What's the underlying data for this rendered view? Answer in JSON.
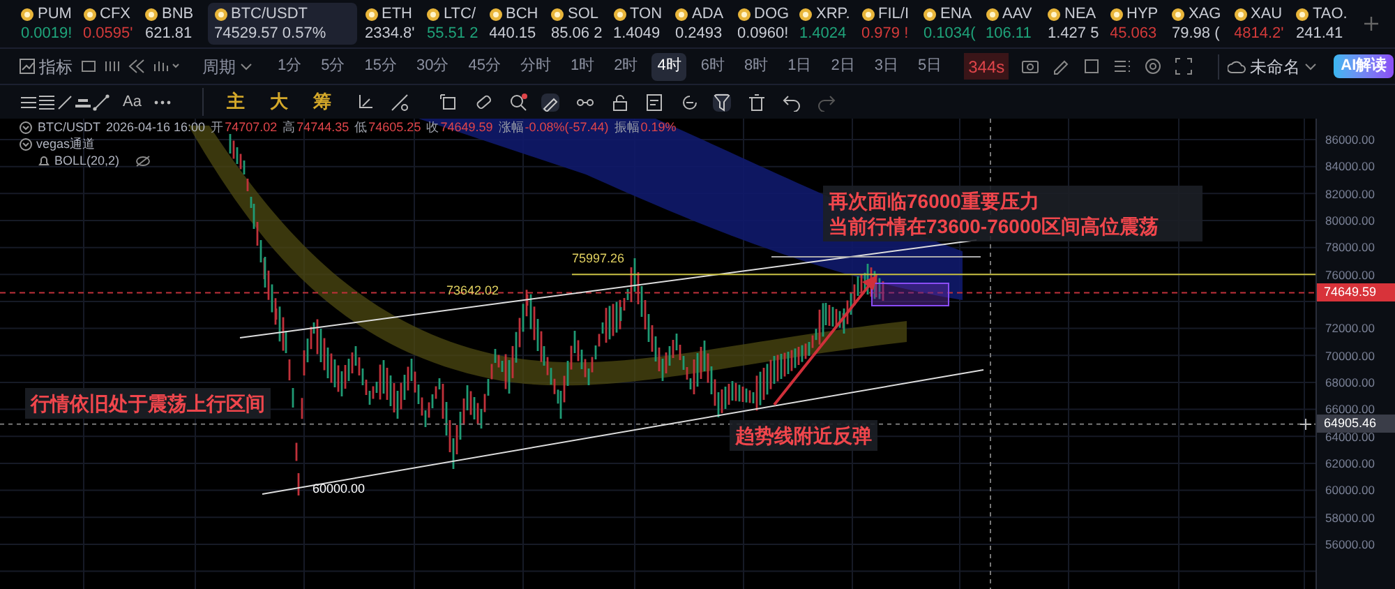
{
  "tickers": [
    {
      "symbol": "PUM",
      "price": "0.0019!",
      "color": "#1fa37a",
      "selected": false
    },
    {
      "symbol": "CFX",
      "price": "0.0595'",
      "color": "#d33a3a",
      "selected": false
    },
    {
      "symbol": "BNB",
      "price": "621.81",
      "color": "#c9ccd4",
      "selected": false
    },
    {
      "symbol": "BTC/USDT",
      "price": "74529.57",
      "change": "0.57%",
      "color": "#c9ccd4",
      "selected": true
    },
    {
      "symbol": "ETH",
      "price": "2334.8'",
      "color": "#c9ccd4",
      "selected": false
    },
    {
      "symbol": "LTC/",
      "price": "55.51 2",
      "color": "#1fa37a",
      "selected": false
    },
    {
      "symbol": "BCH",
      "price": "440.15",
      "color": "#c9ccd4",
      "selected": false
    },
    {
      "symbol": "SOL",
      "price": "85.06 2",
      "color": "#c9ccd4",
      "selected": false
    },
    {
      "symbol": "TON",
      "price": "1.4049",
      "color": "#c9ccd4",
      "selected": false
    },
    {
      "symbol": "ADA",
      "price": "0.2493",
      "color": "#c9ccd4",
      "selected": false
    },
    {
      "symbol": "DOG",
      "price": "0.0960!",
      "color": "#c9ccd4",
      "selected": false
    },
    {
      "symbol": "XRP.",
      "price": "1.4024",
      "color": "#1fa37a",
      "selected": false
    },
    {
      "symbol": "FIL/I",
      "price": "0.979 !",
      "color": "#d33a3a",
      "selected": false
    },
    {
      "symbol": "ENA",
      "price": "0.1034(",
      "color": "#1fa37a",
      "selected": false
    },
    {
      "symbol": "AAV",
      "price": "106.11",
      "color": "#1fa37a",
      "selected": false
    },
    {
      "symbol": "NEA",
      "price": "1.427 5",
      "color": "#c9ccd4",
      "selected": false
    },
    {
      "symbol": "HYP",
      "price": "45.063",
      "color": "#d33a3a",
      "selected": false
    },
    {
      "symbol": "XAG",
      "price": "79.98 (",
      "color": "#c9ccd4",
      "selected": false
    },
    {
      "symbol": "XAU",
      "price": "4814.2'",
      "color": "#d33a3a",
      "selected": false
    },
    {
      "symbol": "TAO.",
      "price": "241.41",
      "color": "#c9ccd4",
      "selected": false
    }
  ],
  "toolbar": {
    "indicator_label": "指标",
    "period_label": "周期",
    "intervals": [
      {
        "label": "1分",
        "selected": false
      },
      {
        "label": "5分",
        "selected": false
      },
      {
        "label": "15分",
        "selected": false
      },
      {
        "label": "30分",
        "selected": false
      },
      {
        "label": "45分",
        "selected": false
      },
      {
        "label": "分时",
        "selected": false
      },
      {
        "label": "1时",
        "selected": false
      },
      {
        "label": "2时",
        "selected": false
      },
      {
        "label": "4时",
        "selected": true
      },
      {
        "label": "6时",
        "selected": false
      },
      {
        "label": "8时",
        "selected": false
      },
      {
        "label": "1日",
        "selected": false
      },
      {
        "label": "2日",
        "selected": false
      },
      {
        "label": "3日",
        "selected": false
      },
      {
        "label": "5日",
        "selected": false
      }
    ],
    "timer": "344s",
    "layout_name": "未命名",
    "ai_button": "AI解读"
  },
  "drawing_toolbar": {
    "font_button": "Aa",
    "overlay_buttons": [
      "主",
      "大",
      "筹"
    ]
  },
  "legend": {
    "symbol": "BTC/USDT",
    "time": "2026-04-16 16:00",
    "fields": [
      {
        "label": "开",
        "value": "74707.02"
      },
      {
        "label": "高",
        "value": "74744.35"
      },
      {
        "label": "低",
        "value": "74605.25"
      },
      {
        "label": "收",
        "value": "74649.59"
      },
      {
        "label": "涨幅",
        "value": "-0.08%(-57.44)"
      },
      {
        "label": "振幅",
        "value": "0.19%"
      }
    ],
    "indicators": [
      "vegas通道",
      "BOLL(20,2)"
    ]
  },
  "chart": {
    "price_labels": [
      {
        "text": "75997.26"
      },
      {
        "text": "73642.02"
      },
      {
        "text": "60000.00"
      }
    ],
    "annotations": [
      {
        "lines": [
          "再次面临76000重要压力",
          "当前行情在73600-76000区间高位震荡"
        ]
      },
      {
        "lines": [
          "行情依旧处于震荡上行区间"
        ]
      },
      {
        "lines": [
          "趋势线附近反弹"
        ]
      }
    ],
    "axis_ticks_upper": [
      "86000.00",
      "84000.00",
      "82000.00",
      "80000.00",
      "78000.00",
      "76000.00"
    ],
    "axis_ticks_lower": [
      "72000.00",
      "70000.00",
      "68000.00",
      "66000.00",
      "64000.00",
      "62000.00",
      "60000.00",
      "58000.00",
      "56000.00"
    ],
    "last_price_tag": "74649.59",
    "crosshair_price_tag": "64905.46"
  }
}
